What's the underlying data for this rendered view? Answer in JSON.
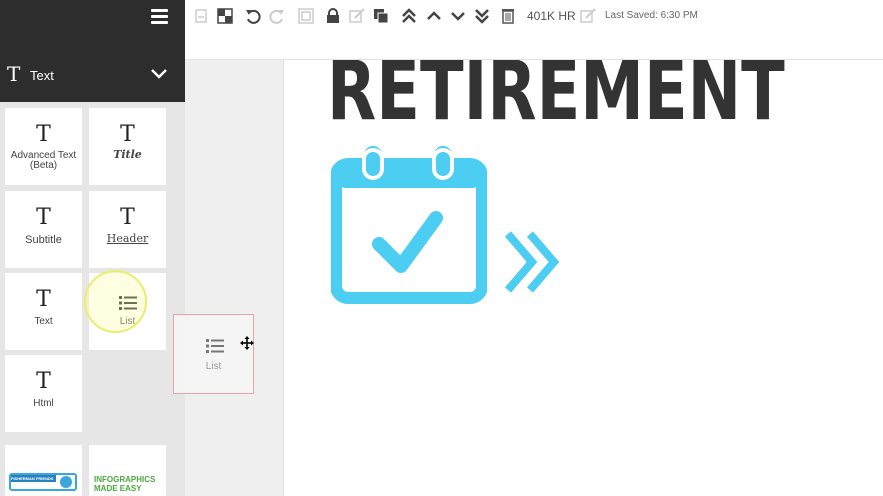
{
  "toolbar": {
    "filesize": "401K HR",
    "last_saved": "Last Saved: 6:30 PM"
  },
  "sidebar": {
    "section_icon": "T",
    "section_title": "Text",
    "items": [
      {
        "icon": "T",
        "label": "Advanced Text (Beta)"
      },
      {
        "icon": "T",
        "label": "Title"
      },
      {
        "icon": "T",
        "label": "Subtitle"
      },
      {
        "icon": "T",
        "label": "Header"
      },
      {
        "icon": "T",
        "label": "Text"
      },
      {
        "icon": "list-icon",
        "label": "List"
      },
      {
        "icon": "T",
        "label": "Html"
      }
    ],
    "thumbnails": [
      {
        "label": "FISHERMAN FRIENDS"
      },
      {
        "label": "INFOGRAPHICS MADE EASY"
      }
    ]
  },
  "canvas": {
    "heading": "RETIREMENT"
  },
  "drag_ghost": {
    "label": "List"
  },
  "colors": {
    "sidebar_header": "#2d2d2e",
    "accent_cyan": "#4ccdf2",
    "drag_border": "#e7a3ae"
  }
}
